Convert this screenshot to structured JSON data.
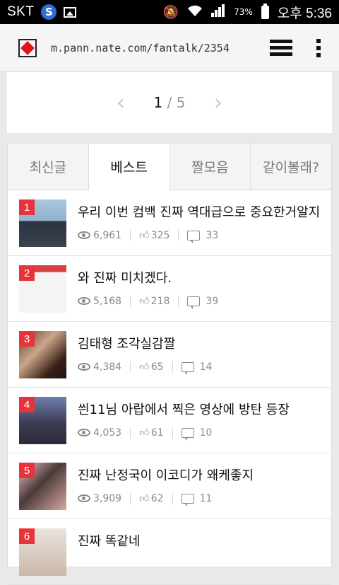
{
  "statusbar": {
    "carrier": "SKT",
    "battery_pct": "73%",
    "time": "오후 5:36"
  },
  "browser": {
    "url": "m.pann.nate.com/fantalk/2354",
    "icons": [
      "nate-favicon",
      "tabs-icon",
      "overflow-menu-icon"
    ]
  },
  "pager": {
    "current": "1",
    "separator": "/",
    "total": "5"
  },
  "tabs": [
    {
      "label": "최신글",
      "active": false
    },
    {
      "label": "베스트",
      "active": true
    },
    {
      "label": "짤모음",
      "active": false
    },
    {
      "label": "같이볼래?",
      "active": false
    }
  ],
  "items": [
    {
      "rank": "1",
      "title": "우리 이번 컴백 진짜 역대급으로 중요한거알지",
      "views": "6,961",
      "likes": "325",
      "comments": "33"
    },
    {
      "rank": "2",
      "title": "와 진짜 미치겠다.",
      "views": "5,168",
      "likes": "218",
      "comments": "39"
    },
    {
      "rank": "3",
      "title": "김태형 조각실감짤",
      "views": "4,384",
      "likes": "65",
      "comments": "14"
    },
    {
      "rank": "4",
      "title": "씐11님 아랍에서 찍은 영상에 방탄 등장",
      "views": "4,053",
      "likes": "61",
      "comments": "10"
    },
    {
      "rank": "5",
      "title": "진짜 난정국이 이코디가 왜케좋지",
      "views": "3,909",
      "likes": "62",
      "comments": "11"
    },
    {
      "rank": "6",
      "title": "진짜 똑같네",
      "views": "",
      "likes": "",
      "comments": ""
    }
  ],
  "colors": {
    "rank_badge": "#e8333a",
    "accent_logo": "#e0121b"
  }
}
